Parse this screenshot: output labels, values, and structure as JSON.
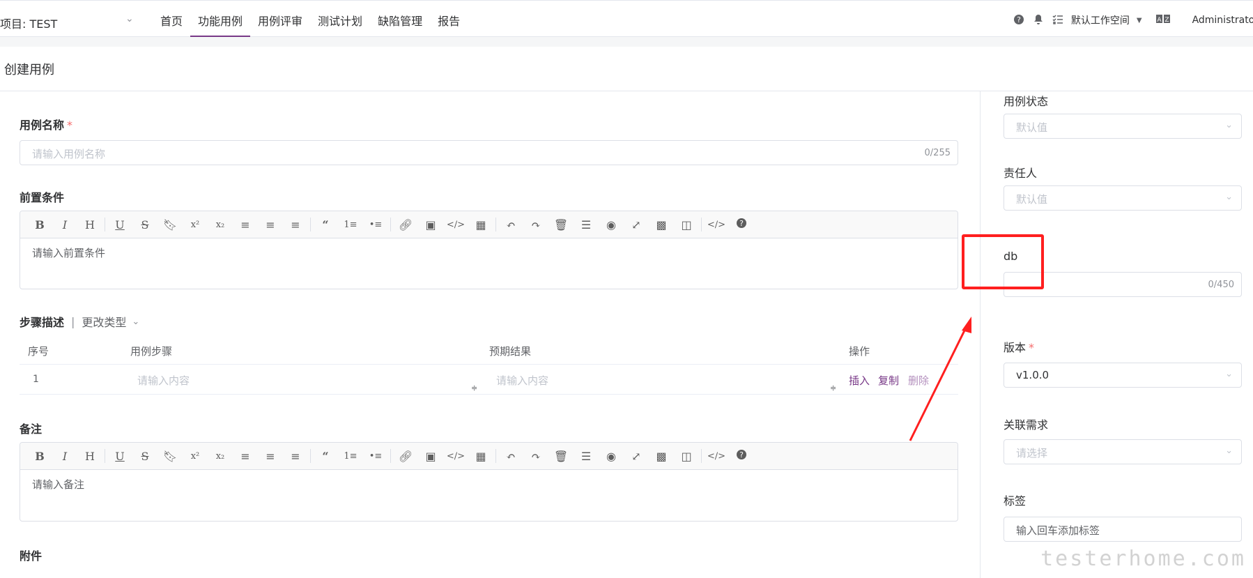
{
  "header": {
    "project": "项目: TEST",
    "nav": [
      "首页",
      "功能用例",
      "用例评审",
      "测试计划",
      "缺陷管理",
      "报告"
    ],
    "active_nav": "功能用例",
    "workspace": "默认工作空间",
    "user": "Administrator"
  },
  "page": {
    "title": "创建用例"
  },
  "form": {
    "name_label": "用例名称",
    "required_mark": "*",
    "name_placeholder": "请输入用例名称",
    "name_count": "0/255",
    "precondition_label": "前置条件",
    "precondition_placeholder": "请输入前置条件",
    "steps_label": "步骤描述",
    "steps_separator": "|",
    "change_type": "更改类型",
    "columns": [
      "序号",
      "用例步骤",
      "预期结果",
      "操作"
    ],
    "step_rows": [
      {
        "index": "1",
        "step_placeholder": "请输入内容",
        "result_placeholder": "请输入内容"
      }
    ],
    "actions": {
      "insert": "插入",
      "copy": "复制",
      "delete": "删除"
    },
    "remark_label": "备注",
    "remark_placeholder": "请输入备注",
    "attachment_label": "附件"
  },
  "side": {
    "status_label": "用例状态",
    "status_value": "默认值",
    "owner_label": "责任人",
    "owner_value": "默认值",
    "db_label": "db",
    "db_count": "0/450",
    "version_label": "版本",
    "version_value": "v1.0.0",
    "requirement_label": "关联需求",
    "requirement_placeholder": "请选择",
    "tags_label": "标签",
    "tags_placeholder": "输入回车添加标签"
  },
  "watermark": "testerhome.com",
  "colors": {
    "accent": "#783887",
    "required": "#f56c6c",
    "annotation": "#ff1f1f"
  }
}
